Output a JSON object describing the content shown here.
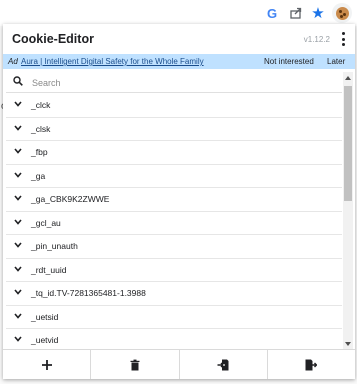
{
  "app": {
    "title": "Cookie-Editor",
    "version": "v1.12.2"
  },
  "ad": {
    "label": "Ad",
    "link_text": "Aura | Intelligent Digital Safety for the Whole Family",
    "not_interested": "Not interested",
    "later": "Later"
  },
  "search": {
    "placeholder": "Search"
  },
  "cookies": [
    "_clck",
    "_clsk",
    "_fbp",
    "_ga",
    "_ga_CBK9K2ZWWE",
    "_gcl_au",
    "_pin_unauth",
    "_rdt_uuid",
    "_tq_id.TV-7281365481-1.3988",
    "_uetsid",
    "_uetvid"
  ],
  "colors": {
    "ad_bg": "#bfe1ff",
    "star": "#1a73e8"
  },
  "icons": [
    "google-icon",
    "share-icon",
    "star-icon",
    "cookie-extension-icon",
    "menu-icon",
    "search-icon",
    "chevron-down-icon",
    "add-icon",
    "delete-icon",
    "import-icon",
    "export-icon"
  ]
}
